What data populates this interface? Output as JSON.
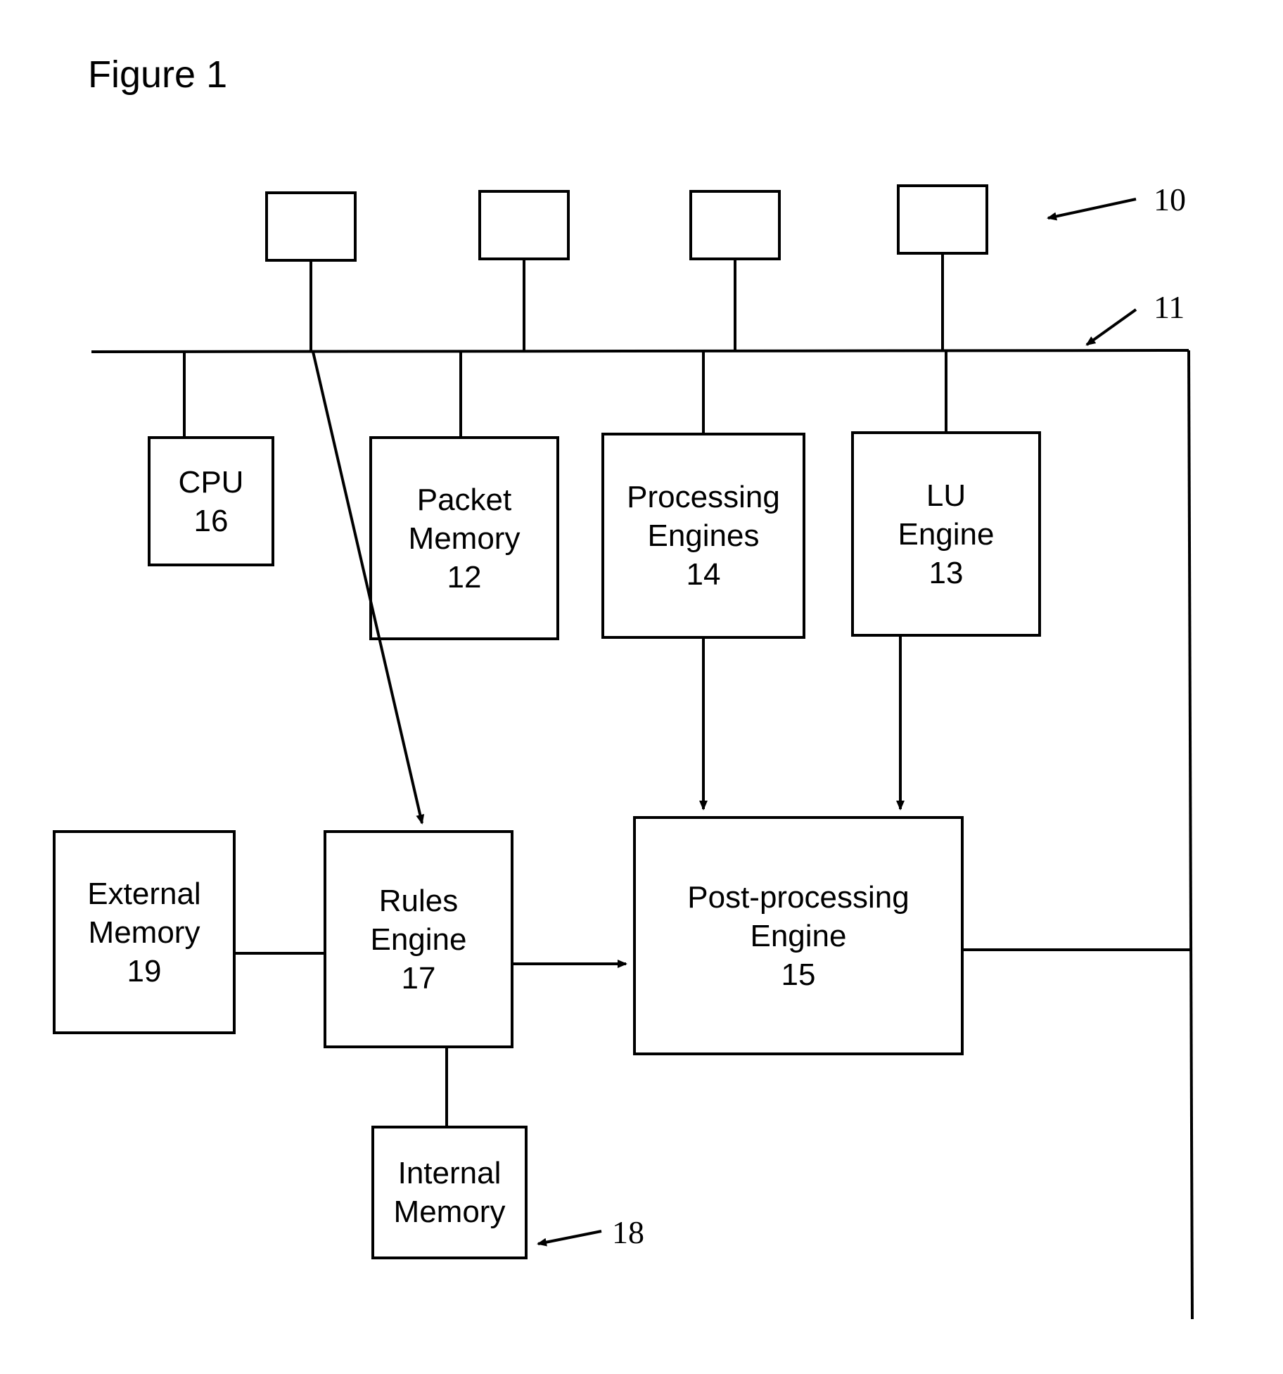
{
  "title": "Figure 1",
  "refs": {
    "r10": "10",
    "r11": "11",
    "r18": "18"
  },
  "boxes": {
    "cpu": {
      "line1": "CPU",
      "line2": "16"
    },
    "packet_memory": {
      "line1": "Packet",
      "line2": "Memory",
      "line3": "12"
    },
    "processing_engines": {
      "line1": "Processing",
      "line2": "Engines",
      "line3": "14"
    },
    "lu_engine": {
      "line1": "LU",
      "line2": "Engine",
      "line3": "13"
    },
    "external_memory": {
      "line1": "External",
      "line2": "Memory",
      "line3": "19"
    },
    "rules_engine": {
      "line1": "Rules",
      "line2": "Engine",
      "line3": "17"
    },
    "post_processing": {
      "line1": "Post-processing",
      "line2": "Engine",
      "line3": "15"
    },
    "internal_memory": {
      "line1": "Internal",
      "line2": "Memory"
    }
  }
}
